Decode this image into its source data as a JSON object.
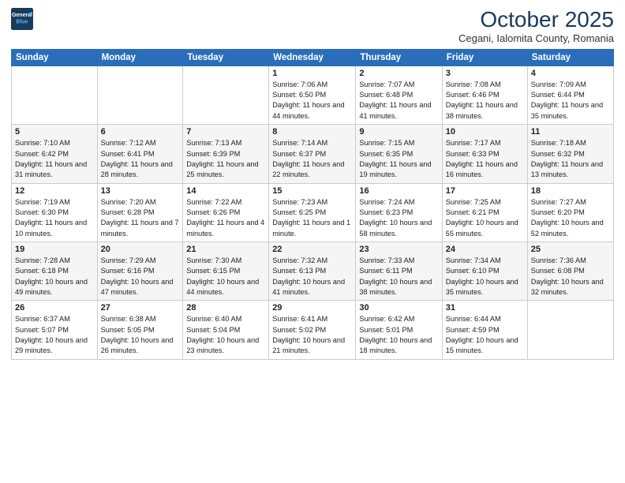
{
  "logo": {
    "line1": "General",
    "line2": "Blue"
  },
  "title": "October 2025",
  "subtitle": "Cegani, Ialomita County, Romania",
  "days_of_week": [
    "Sunday",
    "Monday",
    "Tuesday",
    "Wednesday",
    "Thursday",
    "Friday",
    "Saturday"
  ],
  "weeks": [
    [
      {
        "day": "",
        "info": ""
      },
      {
        "day": "",
        "info": ""
      },
      {
        "day": "",
        "info": ""
      },
      {
        "day": "1",
        "info": "Sunrise: 7:06 AM\nSunset: 6:50 PM\nDaylight: 11 hours and 44 minutes."
      },
      {
        "day": "2",
        "info": "Sunrise: 7:07 AM\nSunset: 6:48 PM\nDaylight: 11 hours and 41 minutes."
      },
      {
        "day": "3",
        "info": "Sunrise: 7:08 AM\nSunset: 6:46 PM\nDaylight: 11 hours and 38 minutes."
      },
      {
        "day": "4",
        "info": "Sunrise: 7:09 AM\nSunset: 6:44 PM\nDaylight: 11 hours and 35 minutes."
      }
    ],
    [
      {
        "day": "5",
        "info": "Sunrise: 7:10 AM\nSunset: 6:42 PM\nDaylight: 11 hours and 31 minutes."
      },
      {
        "day": "6",
        "info": "Sunrise: 7:12 AM\nSunset: 6:41 PM\nDaylight: 11 hours and 28 minutes."
      },
      {
        "day": "7",
        "info": "Sunrise: 7:13 AM\nSunset: 6:39 PM\nDaylight: 11 hours and 25 minutes."
      },
      {
        "day": "8",
        "info": "Sunrise: 7:14 AM\nSunset: 6:37 PM\nDaylight: 11 hours and 22 minutes."
      },
      {
        "day": "9",
        "info": "Sunrise: 7:15 AM\nSunset: 6:35 PM\nDaylight: 11 hours and 19 minutes."
      },
      {
        "day": "10",
        "info": "Sunrise: 7:17 AM\nSunset: 6:33 PM\nDaylight: 11 hours and 16 minutes."
      },
      {
        "day": "11",
        "info": "Sunrise: 7:18 AM\nSunset: 6:32 PM\nDaylight: 11 hours and 13 minutes."
      }
    ],
    [
      {
        "day": "12",
        "info": "Sunrise: 7:19 AM\nSunset: 6:30 PM\nDaylight: 11 hours and 10 minutes."
      },
      {
        "day": "13",
        "info": "Sunrise: 7:20 AM\nSunset: 6:28 PM\nDaylight: 11 hours and 7 minutes."
      },
      {
        "day": "14",
        "info": "Sunrise: 7:22 AM\nSunset: 6:26 PM\nDaylight: 11 hours and 4 minutes."
      },
      {
        "day": "15",
        "info": "Sunrise: 7:23 AM\nSunset: 6:25 PM\nDaylight: 11 hours and 1 minute."
      },
      {
        "day": "16",
        "info": "Sunrise: 7:24 AM\nSunset: 6:23 PM\nDaylight: 10 hours and 58 minutes."
      },
      {
        "day": "17",
        "info": "Sunrise: 7:25 AM\nSunset: 6:21 PM\nDaylight: 10 hours and 55 minutes."
      },
      {
        "day": "18",
        "info": "Sunrise: 7:27 AM\nSunset: 6:20 PM\nDaylight: 10 hours and 52 minutes."
      }
    ],
    [
      {
        "day": "19",
        "info": "Sunrise: 7:28 AM\nSunset: 6:18 PM\nDaylight: 10 hours and 49 minutes."
      },
      {
        "day": "20",
        "info": "Sunrise: 7:29 AM\nSunset: 6:16 PM\nDaylight: 10 hours and 47 minutes."
      },
      {
        "day": "21",
        "info": "Sunrise: 7:30 AM\nSunset: 6:15 PM\nDaylight: 10 hours and 44 minutes."
      },
      {
        "day": "22",
        "info": "Sunrise: 7:32 AM\nSunset: 6:13 PM\nDaylight: 10 hours and 41 minutes."
      },
      {
        "day": "23",
        "info": "Sunrise: 7:33 AM\nSunset: 6:11 PM\nDaylight: 10 hours and 38 minutes."
      },
      {
        "day": "24",
        "info": "Sunrise: 7:34 AM\nSunset: 6:10 PM\nDaylight: 10 hours and 35 minutes."
      },
      {
        "day": "25",
        "info": "Sunrise: 7:36 AM\nSunset: 6:08 PM\nDaylight: 10 hours and 32 minutes."
      }
    ],
    [
      {
        "day": "26",
        "info": "Sunrise: 6:37 AM\nSunset: 5:07 PM\nDaylight: 10 hours and 29 minutes."
      },
      {
        "day": "27",
        "info": "Sunrise: 6:38 AM\nSunset: 5:05 PM\nDaylight: 10 hours and 26 minutes."
      },
      {
        "day": "28",
        "info": "Sunrise: 6:40 AM\nSunset: 5:04 PM\nDaylight: 10 hours and 23 minutes."
      },
      {
        "day": "29",
        "info": "Sunrise: 6:41 AM\nSunset: 5:02 PM\nDaylight: 10 hours and 21 minutes."
      },
      {
        "day": "30",
        "info": "Sunrise: 6:42 AM\nSunset: 5:01 PM\nDaylight: 10 hours and 18 minutes."
      },
      {
        "day": "31",
        "info": "Sunrise: 6:44 AM\nSunset: 4:59 PM\nDaylight: 10 hours and 15 minutes."
      },
      {
        "day": "",
        "info": ""
      }
    ]
  ]
}
